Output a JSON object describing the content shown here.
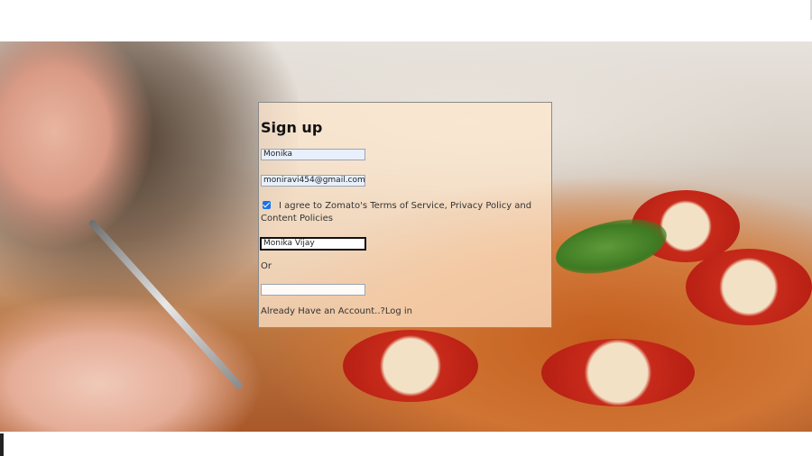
{
  "signup": {
    "title": "Sign up",
    "name_value": "Monika",
    "email_value": "moniravi454@gmail.com",
    "agree_text": "I agree to Zomato's Terms of Service, Privacy Policy and Content Policies",
    "fullname_value": "Monika Vijay",
    "or_text": "Or",
    "login_prompt": "Already Have an Account..?",
    "login_link": "Log in"
  }
}
